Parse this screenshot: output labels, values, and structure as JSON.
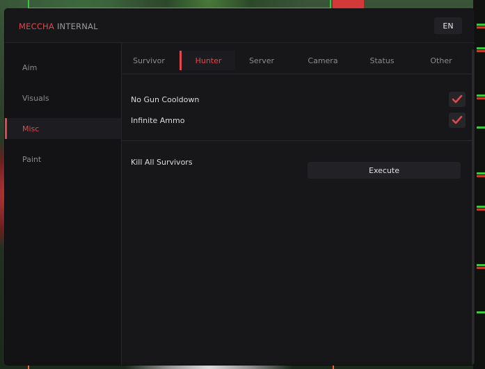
{
  "window": {
    "brand_primary": "MECCHA",
    "brand_secondary": "INTERNAL",
    "language": "EN"
  },
  "sidebar": {
    "items": [
      {
        "label": "Aim"
      },
      {
        "label": "Visuals"
      },
      {
        "label": "Misc",
        "active": true
      },
      {
        "label": "Paint"
      }
    ]
  },
  "tabs": [
    {
      "label": "Survivor"
    },
    {
      "label": "Hunter",
      "active": true
    },
    {
      "label": "Server"
    },
    {
      "label": "Camera"
    },
    {
      "label": "Status"
    },
    {
      "label": "Other"
    }
  ],
  "options": [
    {
      "label": "No Gun Cooldown",
      "checked": true
    },
    {
      "label": "Infinite Ammo",
      "checked": true
    }
  ],
  "action": {
    "label": "Kill All Survivors",
    "button_label": "Execute"
  },
  "colors": {
    "accent": "#e2474d",
    "window_bg": "#17171a",
    "sidebar_bg": "#131316"
  }
}
